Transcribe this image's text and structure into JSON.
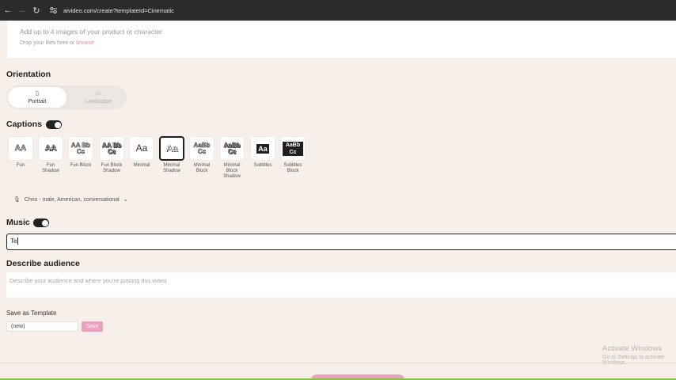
{
  "browser": {
    "url": "aivideo.com/create?templateId=Cinematic"
  },
  "upload": {
    "title": "Add up to 4 images of your product or character",
    "subtitle_prefix": "Drop your files here or ",
    "browse_link": "browse"
  },
  "orientation": {
    "heading": "Orientation",
    "options": [
      {
        "label": "Portrait",
        "icon": "▯",
        "selected": true
      },
      {
        "label": "Landscape",
        "icon": "▭",
        "selected": false
      }
    ]
  },
  "captions": {
    "heading": "Captions",
    "enabled": true,
    "styles": [
      {
        "label": "Fun",
        "sample": "AA"
      },
      {
        "label": "Fun Shadow",
        "sample": "AA"
      },
      {
        "label": "Fun Block",
        "sample": "AA Bb Cc"
      },
      {
        "label": "Fun Block Shadow",
        "sample": "AA Bb Cc"
      },
      {
        "label": "Minimal",
        "sample": "Aa"
      },
      {
        "label": "Minimal Shadow",
        "sample": "Aa",
        "selected": true
      },
      {
        "label": "Minimal Block",
        "sample": "AaBb Cc"
      },
      {
        "label": "Minimal Block Shadow",
        "sample": "AaBb Cc"
      },
      {
        "label": "Subtitles",
        "sample": "Aa"
      },
      {
        "label": "Subtitles Block",
        "sample": "AaBb Cc"
      }
    ]
  },
  "voice": {
    "value": "Chris - male, American, conversational"
  },
  "music": {
    "heading": "Music",
    "enabled": true,
    "input_value": "Te"
  },
  "audience": {
    "heading": "Describe audience",
    "placeholder": "Describe your audience and where you're posting this video"
  },
  "template": {
    "label": "Save as Template",
    "input_value": "(new)",
    "save_label": "Save"
  },
  "watermark": {
    "line1": "Activate Windows",
    "line2": "Go to Settings to activate Windows."
  },
  "colors": {
    "accent": "#e9a1bd",
    "background": "#f7efe9"
  }
}
